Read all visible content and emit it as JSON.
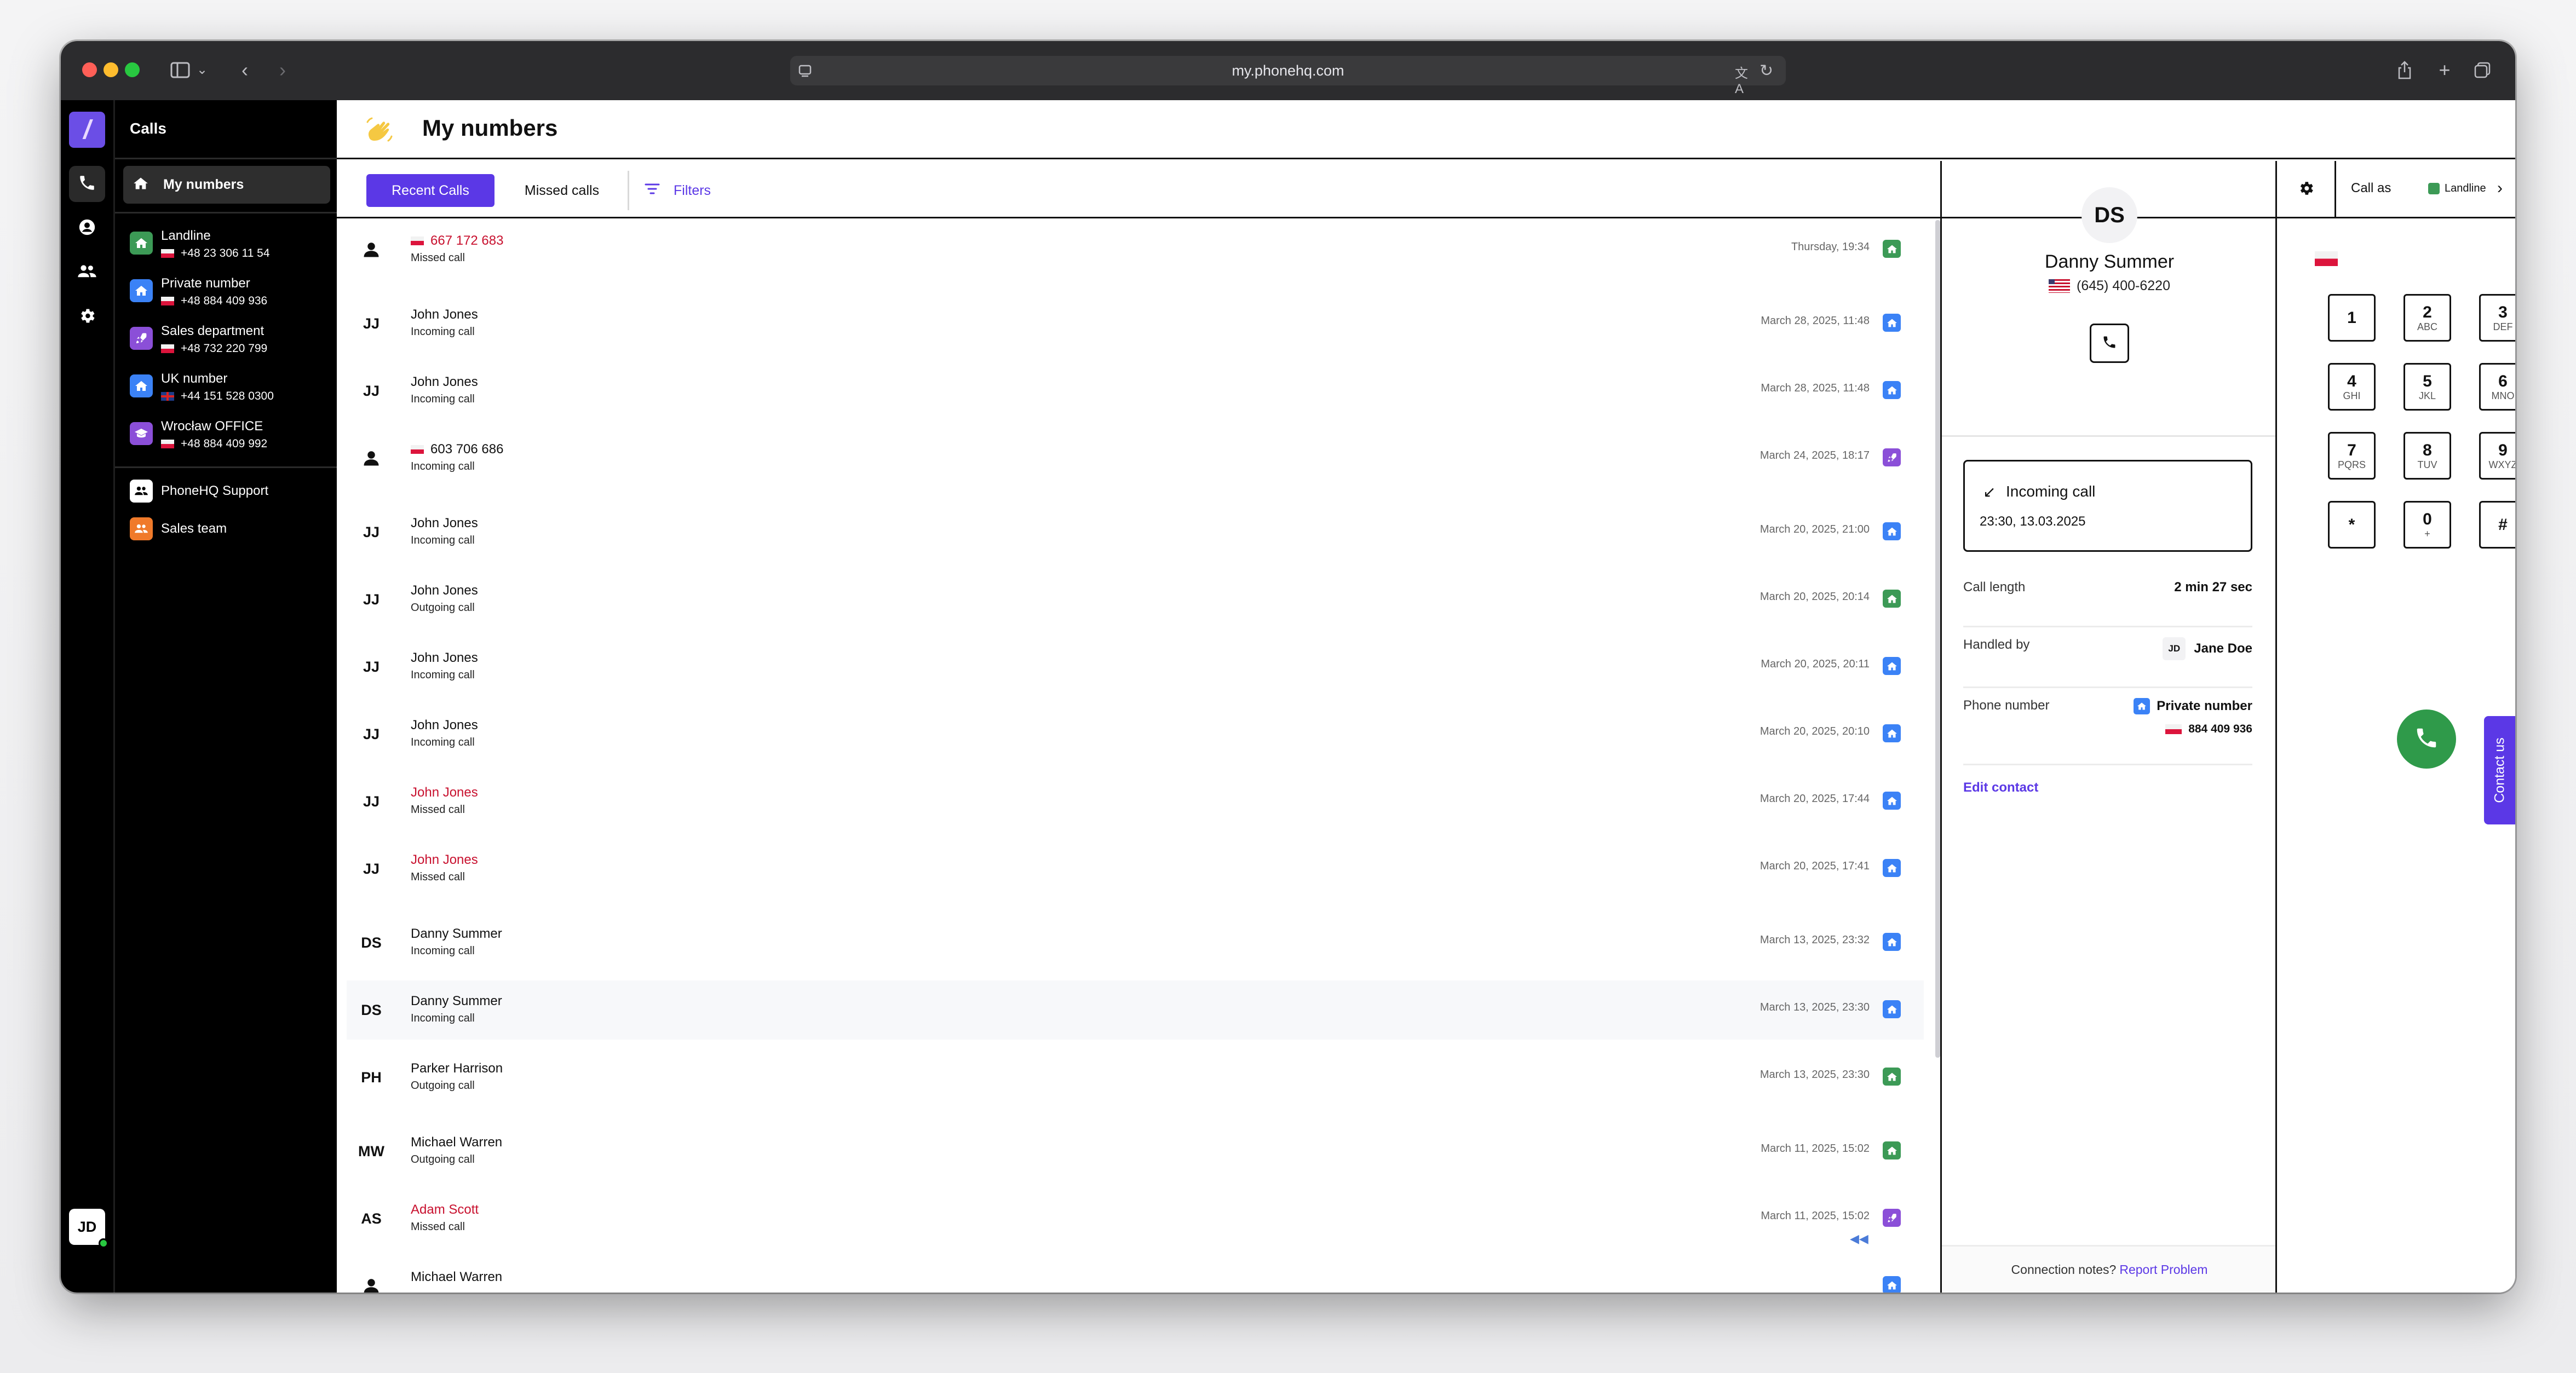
{
  "browser": {
    "url": "my.phonehq.com"
  },
  "colors": {
    "accent": "#5b38e6",
    "missed": "#c8102e",
    "green": "#3c9a56",
    "blue": "#3b82f6",
    "purple": "#8b4fd8"
  },
  "rail": {
    "user_initials": "JD",
    "icons": [
      "phone-icon",
      "contact-icon",
      "team-icon",
      "gear-icon"
    ]
  },
  "sidebar": {
    "title": "Calls",
    "my_numbers_label": "My numbers",
    "numbers": [
      {
        "name": "Landline",
        "number": "+48 23 306 11 54",
        "flag": "pl",
        "color": "#3c9a56"
      },
      {
        "name": "Private number",
        "number": "+48 884 409 936",
        "flag": "pl",
        "color": "#3b82f6"
      },
      {
        "name": "Sales department",
        "number": "+48 732 220 799",
        "flag": "pl",
        "color": "#8b4fd8"
      },
      {
        "name": "UK number",
        "number": "+44 151 528 0300",
        "flag": "uk",
        "color": "#3b82f6"
      },
      {
        "name": "Wrocław OFFICE",
        "number": "+48 884 409 992",
        "flag": "pl",
        "color": "#8b4fd8"
      }
    ],
    "groups": [
      {
        "name": "PhoneHQ Support",
        "color": "#ffffff"
      },
      {
        "name": "Sales team",
        "color": "#f07a2a"
      }
    ]
  },
  "main": {
    "title": "My numbers",
    "tabs": {
      "recent": "Recent Calls",
      "missed": "Missed calls",
      "filters": "Filters"
    }
  },
  "calls": [
    {
      "initials": "",
      "name": "667 172 683",
      "flag": "pl",
      "status": "Missed call",
      "missed": true,
      "date": "Thursday, 19:34",
      "line": "green"
    },
    {
      "initials": "JJ",
      "name": "John Jones",
      "status": "Incoming call",
      "missed": false,
      "date": "March 28, 2025, 11:48",
      "line": "blue"
    },
    {
      "initials": "JJ",
      "name": "John Jones",
      "status": "Incoming call",
      "missed": false,
      "date": "March 28, 2025, 11:48",
      "line": "blue"
    },
    {
      "initials": "",
      "name": "603 706 686",
      "flag": "pl",
      "status": "Incoming call",
      "missed": false,
      "date": "March 24, 2025, 18:17",
      "line": "purple"
    },
    {
      "initials": "JJ",
      "name": "John Jones",
      "status": "Incoming call",
      "missed": false,
      "date": "March 20, 2025, 21:00",
      "line": "blue"
    },
    {
      "initials": "JJ",
      "name": "John Jones",
      "status": "Outgoing call",
      "missed": false,
      "date": "March 20, 2025, 20:14",
      "line": "green"
    },
    {
      "initials": "JJ",
      "name": "John Jones",
      "status": "Incoming call",
      "missed": false,
      "date": "March 20, 2025, 20:11",
      "line": "blue"
    },
    {
      "initials": "JJ",
      "name": "John Jones",
      "status": "Incoming call",
      "missed": false,
      "date": "March 20, 2025, 20:10",
      "line": "blue"
    },
    {
      "initials": "JJ",
      "name": "John Jones",
      "status": "Missed call",
      "missed": true,
      "date": "March 20, 2025, 17:44",
      "line": "blue"
    },
    {
      "initials": "JJ",
      "name": "John Jones",
      "status": "Missed call",
      "missed": true,
      "date": "March 20, 2025, 17:41",
      "line": "blue"
    },
    {
      "initials": "DS",
      "name": "Danny Summer",
      "status": "Incoming call",
      "missed": false,
      "date": "March 13, 2025, 23:32",
      "line": "blue"
    },
    {
      "initials": "DS",
      "name": "Danny Summer",
      "status": "Incoming call",
      "missed": false,
      "date": "March 13, 2025, 23:30",
      "line": "blue",
      "selected": true
    },
    {
      "initials": "PH",
      "name": "Parker Harrison",
      "status": "Outgoing call",
      "missed": false,
      "date": "March 13, 2025, 23:30",
      "line": "green"
    },
    {
      "initials": "MW",
      "name": "Michael Warren",
      "status": "Outgoing call",
      "missed": false,
      "date": "March 11, 2025, 15:02",
      "line": "green"
    },
    {
      "initials": "AS",
      "name": "Adam Scott",
      "status": "Missed call",
      "missed": true,
      "date": "March 11, 2025, 15:02",
      "line": "purple",
      "extra": true
    },
    {
      "initials": "",
      "name": "Michael Warren",
      "status": "",
      "missed": false,
      "date": "",
      "line": "blue"
    }
  ],
  "detail": {
    "initials": "DS",
    "name": "Danny Summer",
    "phone": "(645) 400-6220",
    "call_type": "Incoming call",
    "call_time": "23:30, 13.03.2025",
    "length_label": "Call length",
    "length_value": "2 min 27 sec",
    "handled_label": "Handled by",
    "handled_initials": "JD",
    "handled_value": "Jane Doe",
    "phone_label": "Phone number",
    "phone_line": "Private number",
    "phone_line_number": "884 409 936",
    "edit_label": "Edit contact",
    "footer_text": "Connection notes?",
    "footer_link": "Report Problem"
  },
  "dialer": {
    "call_as_label": "Call as",
    "call_as_value": "Landline",
    "keys": [
      {
        "d": "1",
        "l": ""
      },
      {
        "d": "2",
        "l": "ABC"
      },
      {
        "d": "3",
        "l": "DEF"
      },
      {
        "d": "4",
        "l": "GHI"
      },
      {
        "d": "5",
        "l": "JKL"
      },
      {
        "d": "6",
        "l": "MNO"
      },
      {
        "d": "7",
        "l": "PQRS"
      },
      {
        "d": "8",
        "l": "TUV"
      },
      {
        "d": "9",
        "l": "WXYZ"
      },
      {
        "d": "*",
        "l": ""
      },
      {
        "d": "0",
        "l": "+"
      },
      {
        "d": "#",
        "l": ""
      }
    ]
  },
  "contact_tab": "Contact us"
}
